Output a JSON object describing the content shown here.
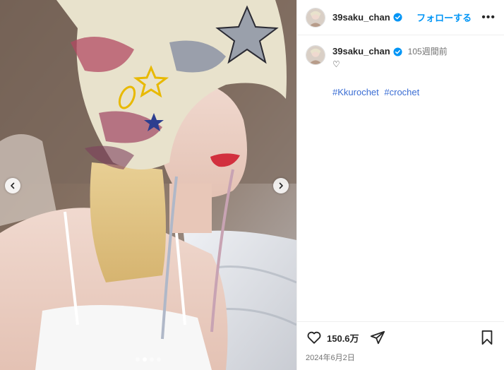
{
  "media": {
    "photo_description_icon": "photo",
    "prev_icon": "chevron-left-icon",
    "next_icon": "chevron-right-icon",
    "slide_count": 4,
    "active_slide": 1
  },
  "header": {
    "username": "39saku_chan",
    "follow_label": "フォローする",
    "more_label": "•••"
  },
  "caption": {
    "username": "39saku_chan",
    "time": "105週間前",
    "text": "♡",
    "hashtags": [
      "#Kkurochet",
      "#crochet"
    ]
  },
  "footer": {
    "likes": "150.6万",
    "date": "2024年6月2日"
  },
  "colors": {
    "accent": "#0095f6",
    "verified": "#0095f6",
    "hashtag": "#3b6ed4"
  }
}
